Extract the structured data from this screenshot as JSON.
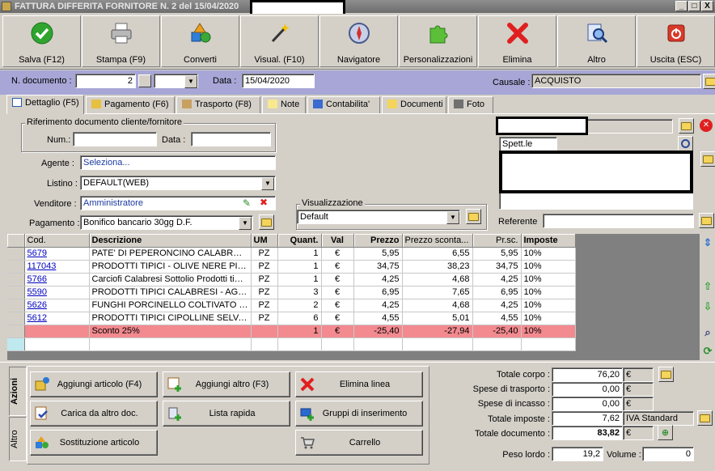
{
  "window": {
    "title": "FATTURA DIFFERITA FORNITORE N. 2 del 15/04/2020",
    "min": "_",
    "max": "□",
    "close": "X"
  },
  "toolbar": {
    "save": "Salva (F12)",
    "print": "Stampa (F9)",
    "convert": "Converti",
    "visual": "Visual. (F10)",
    "navigator": "Navigatore",
    "customize": "Personalizzazioni",
    "delete": "Elimina",
    "other": "Altro",
    "exit": "Uscita (ESC)"
  },
  "header": {
    "doc_number_label": "N. documento :",
    "doc_number": "2",
    "doc_series": "",
    "date_label": "Data :",
    "date": "15/04/2020",
    "causale_label": "Causale :",
    "causale": "ACQUISTO"
  },
  "tabs": [
    {
      "label": "Dettaglio (F5)"
    },
    {
      "label": "Pagamento (F6)"
    },
    {
      "label": "Trasporto (F8)"
    },
    {
      "label": "Note"
    },
    {
      "label": "Contabilita'"
    },
    {
      "label": "Documenti"
    },
    {
      "label": "Foto"
    }
  ],
  "detail": {
    "ref_group": "Riferimento documento cliente/fornitore",
    "num_label": "Num.:",
    "num_value": "",
    "data_label": "Data :",
    "data_value": "",
    "agent_label": "Agente :",
    "agent_value": "Seleziona...",
    "list_label": "Listino :",
    "list_value": "DEFAULT(WEB)",
    "seller_label": "Venditore :",
    "seller_value": "Amministratore",
    "payment_label": "Pagamento :",
    "payment_value": "Bonifico bancario 30gg D.F.",
    "view_group": "Visualizzazione",
    "view_value": "Default",
    "spett": "Spett.le",
    "referente_label": "Referente",
    "referente_value": ""
  },
  "grid": {
    "headers": {
      "code": "Cod.",
      "desc": "Descrizione",
      "um": "UM",
      "qty": "Quant.",
      "val": "Val",
      "price": "Prezzo",
      "disc_price": "Prezzo sconta...",
      "prsc": "Pr.sc.",
      "tax": "Imposte"
    },
    "rows": [
      {
        "code": "5679",
        "desc": "PATE' DI PEPERONCINO CALABRESI ...",
        "um": "PZ",
        "qty": "1",
        "val": "€",
        "price": "5,95",
        "disc_price": "6,55",
        "prsc": "5,95",
        "tax": "10%"
      },
      {
        "code": "117043",
        "desc": "PRODOTTI TIPICI - OLIVE NERE PIAN...",
        "um": "PZ",
        "qty": "1",
        "val": "€",
        "price": "34,75",
        "disc_price": "38,23",
        "prsc": "34,75",
        "tax": "10%"
      },
      {
        "code": "5766",
        "desc": "Carciofi Calabresi Sottolio Prodotti tipi...",
        "um": "PZ",
        "qty": "1",
        "val": "€",
        "price": "4,25",
        "disc_price": "4,68",
        "prsc": "4,25",
        "tax": "10%"
      },
      {
        "code": "5590",
        "desc": "PRODOTTI TIPICI CALABRESI - AGLI...",
        "um": "PZ",
        "qty": "3",
        "val": "€",
        "price": "6,95",
        "disc_price": "7,65",
        "prsc": "6,95",
        "tax": "10%"
      },
      {
        "code": "5626",
        "desc": "FUNGHI PORCINELLO COLTIVATO SP...",
        "um": "PZ",
        "qty": "2",
        "val": "€",
        "price": "4,25",
        "disc_price": "4,68",
        "prsc": "4,25",
        "tax": "10%"
      },
      {
        "code": "5612",
        "desc": "PRODOTTI TIPICI CIPOLLINE SELVAT...",
        "um": "PZ",
        "qty": "6",
        "val": "€",
        "price": "4,55",
        "disc_price": "5,01",
        "prsc": "4,55",
        "tax": "10%"
      }
    ],
    "discount": {
      "code": "",
      "desc": "Sconto 25%",
      "um": "",
      "qty": "1",
      "val": "€",
      "price": "-25,40",
      "disc_price": "-27,94",
      "prsc": "-25,40",
      "tax": "10%"
    }
  },
  "actions": {
    "tab_actions": "Azioni",
    "tab_other": "Altro",
    "add_article": "Aggiungi articolo (F4)",
    "add_other": "Aggiungi altro (F3)",
    "delete_line": "Elimina linea",
    "load_doc": "Carica da altro doc.",
    "quick_list": "Lista rapida",
    "insert_groups": "Gruppi di inserimento",
    "replace_article": "Sostituzione articolo",
    "cart": "Carrello"
  },
  "totals": {
    "body_label": "Totale corpo :",
    "body": "76,20",
    "transport_label": "Spese di trasporto :",
    "transport": "0,00",
    "collection_label": "Spese di incasso :",
    "collection": "0,00",
    "tax_label": "Totale imposte :",
    "tax": "7,62",
    "tax_type": "IVA Standard",
    "doc_label": "Totale documento :",
    "doc": "83,82",
    "currency": "€",
    "weight_label": "Peso lordo :",
    "weight": "19,2",
    "volume_label": "Volume :",
    "volume": "0"
  }
}
